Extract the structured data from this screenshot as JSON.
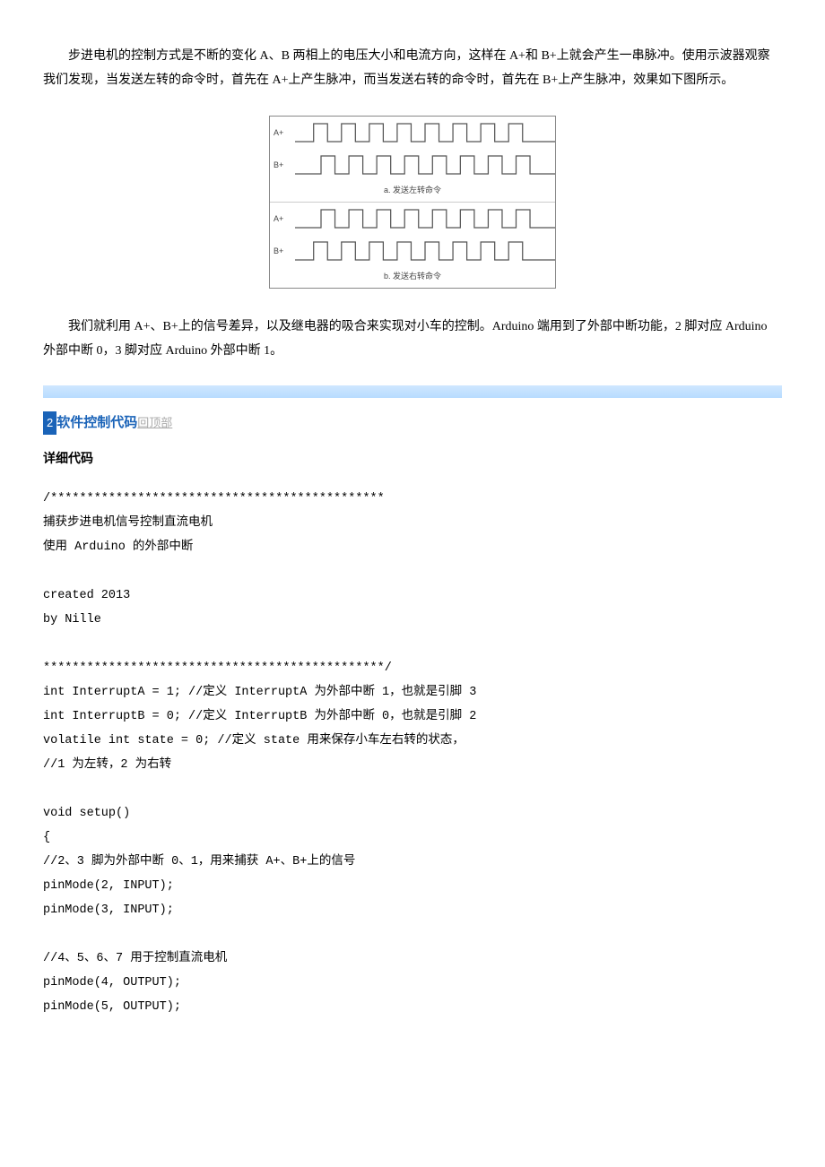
{
  "paragraphs": {
    "p1": "步进电机的控制方式是不断的变化 A、B 两相上的电压大小和电流方向，这样在 A+和 B+上就会产生一串脉冲。使用示波器观察我们发现，当发送左转的命令时，首先在 A+上产生脉冲，而当发送右转的命令时，首先在 B+上产生脉冲，效果如下图所示。",
    "p2": "我们就利用 A+、B+上的信号差异，以及继电器的吸合来实现对小车的控制。Arduino 端用到了外部中断功能，2 脚对应 Arduino 外部中断 0，3 脚对应 Arduino 外部中断 1。"
  },
  "figure": {
    "rows": [
      {
        "label": "A+",
        "phase": 0
      },
      {
        "label": "B+",
        "phase": 1
      }
    ],
    "caption_a": "a. 发送左转命令",
    "rows2": [
      {
        "label": "A+",
        "phase": 1
      },
      {
        "label": "B+",
        "phase": 0
      }
    ],
    "caption_b": "b. 发送右转命令"
  },
  "section": {
    "num": "2",
    "title": "软件控制代码",
    "back": "回顶部"
  },
  "subhead": "详细代码",
  "code": {
    "l01": "/**********************************************",
    "l02": "捕获步进电机信号控制直流电机",
    "l03": "使用 Arduino 的外部中断",
    "l04": "",
    "l05": "created 2013",
    "l06": "by Nille",
    "l07": "",
    "l08": "***********************************************/",
    "l09": "int InterruptA = 1; //定义 InterruptA 为外部中断 1，也就是引脚 3",
    "l10": "int InterruptB = 0; //定义 InterruptB 为外部中断 0，也就是引脚 2",
    "l11": "volatile int state = 0; //定义 state 用来保存小车左右转的状态，",
    "l12": "//1 为左转，2 为右转",
    "l13": "",
    "l14": "void setup()",
    "l15": "{",
    "l16": "//2、3 脚为外部中断 0、1，用来捕获 A+、B+上的信号",
    "l17": "pinMode(2, INPUT);",
    "l18": "pinMode(3, INPUT);",
    "l19": "",
    "l20": "//4、5、6、7 用于控制直流电机",
    "l21": "pinMode(4, OUTPUT);",
    "l22": "pinMode(5, OUTPUT);"
  }
}
